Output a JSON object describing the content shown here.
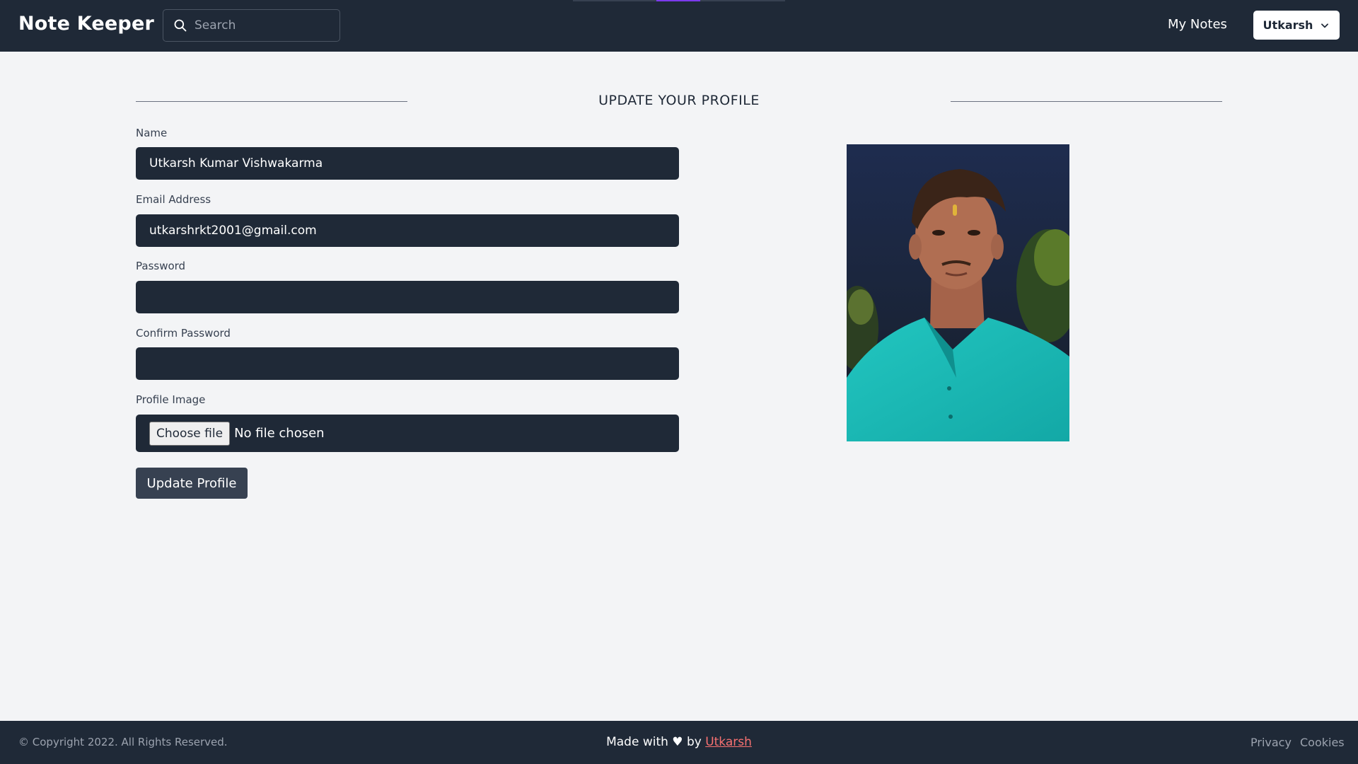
{
  "navbar": {
    "brand": "Note Keeper",
    "search_placeholder": "Search",
    "my_notes": "My Notes",
    "user_menu_label": "Utkarsh"
  },
  "main": {
    "title": "UPDATE YOUR PROFILE",
    "fields": {
      "name_label": "Name",
      "name_value": "Utkarsh Kumar Vishwakarma",
      "email_label": "Email Address",
      "email_value": "utkarshrkt2001@gmail.com",
      "password_label": "Password",
      "password_value": "",
      "confirm_password_label": "Confirm Password",
      "confirm_password_value": "",
      "profile_image_label": "Profile Image",
      "choose_file_label": "Choose file",
      "file_status": "No file chosen"
    },
    "update_button": "Update Profile"
  },
  "footer": {
    "copyright": "© Copyright 2022. All Rights Reserved.",
    "made_with_prefix": "Made with ♥ by ",
    "author_link": "Utkarsh",
    "privacy": "Privacy",
    "cookies": "Cookies"
  },
  "icons": {
    "search": "search-icon",
    "dropdown": "chevron-down-icon"
  },
  "colors": {
    "navbar_bg": "#1f2937",
    "page_bg": "#f3f4f6",
    "input_bg": "#1f2937",
    "accent_link": "#f87171",
    "button_bg": "#374151"
  }
}
